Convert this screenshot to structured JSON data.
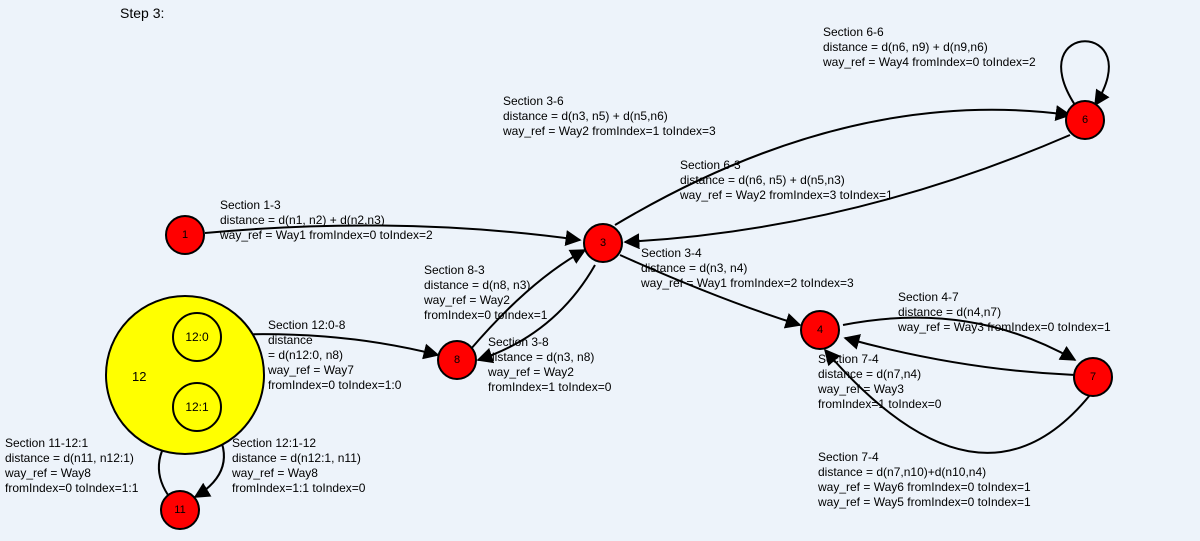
{
  "title": "Step 3:",
  "nodes": {
    "n1": "1",
    "n3": "3",
    "n4": "4",
    "n6": "6",
    "n7": "7",
    "n8": "8",
    "n11": "11",
    "n12": "12",
    "n12_0": "12:0",
    "n12_1": "12:1"
  },
  "sections": {
    "s66": {
      "title": "Section 6-6",
      "distance": "distance = d(n6, n9) + d(n9,n6)",
      "way": "way_ref = Way4 fromIndex=0 toIndex=2"
    },
    "s36": {
      "title": "Section 3-6",
      "distance": "distance = d(n3, n5) + d(n5,n6)",
      "way": "way_ref = Way2 fromIndex=1 toIndex=3"
    },
    "s63": {
      "title": "Section 6-3",
      "distance": "distance = d(n6, n5) + d(n5,n3)",
      "way": "way_ref = Way2 fromIndex=3 toIndex=1"
    },
    "s13": {
      "title": "Section 1-3",
      "distance": "distance = d(n1, n2) + d(n2,n3)",
      "way": "way_ref = Way1 fromIndex=0 toIndex=2"
    },
    "s34": {
      "title": "Section 3-4",
      "distance": "distance = d(n3, n4)",
      "way": "way_ref = Way1 fromIndex=2 toIndex=3"
    },
    "s83": {
      "title": "Section 8-3",
      "distance": "distance = d(n8, n3)",
      "way": "way_ref = Way2",
      "way2": "fromIndex=0 toIndex=1"
    },
    "s38": {
      "title": "Section 3-8",
      "distance": "distance = d(n3, n8)",
      "way": "way_ref = Way2",
      "way2": "fromIndex=1 toIndex=0"
    },
    "s47": {
      "title": "Section 4-7",
      "distance": "distance = d(n4,n7)",
      "way": "way_ref = Way3 fromIndex=0 toIndex=1"
    },
    "s74a": {
      "title": "Section 7-4",
      "distance": "distance = d(n7,n4)",
      "way": "way_ref = Way3",
      "way2": "fromIndex=1 toIndex=0"
    },
    "s74b": {
      "title": "Section 7-4",
      "distance": "distance = d(n7,n10)+d(n10,n4)",
      "way": "way_ref = Way6 fromIndex=0 toIndex=1",
      "way2": "way_ref = Way5 fromIndex=0 toIndex=1"
    },
    "s12_0_8": {
      "title": "Section 12:0-8",
      "distance": "distance",
      "distance2": "= d(n12:0, n8)",
      "way": "way_ref = Way7",
      "way2": "fromIndex=0 toIndex=1:0"
    },
    "s11_12_1": {
      "title": "Section 11-12:1",
      "distance": "distance = d(n11, n12:1)",
      "way": "way_ref = Way8",
      "way2": "fromIndex=0 toIndex=1:1"
    },
    "s12_1_12": {
      "title": "Section 12:1-12",
      "distance": "distance = d(n12:1, n11)",
      "way": "way_ref = Way8",
      "way2": "fromIndex=1:1 toIndex=0"
    }
  },
  "chart_data": {
    "type": "diagram",
    "title": "Step 3:",
    "nodes": [
      {
        "id": 1,
        "label": "1"
      },
      {
        "id": 3,
        "label": "3"
      },
      {
        "id": 4,
        "label": "4"
      },
      {
        "id": 6,
        "label": "6"
      },
      {
        "id": 7,
        "label": "7"
      },
      {
        "id": 8,
        "label": "8"
      },
      {
        "id": 11,
        "label": "11"
      },
      {
        "id": 12,
        "label": "12",
        "sub": [
          "12:0",
          "12:1"
        ]
      }
    ],
    "edges": [
      {
        "section": "1-3",
        "from": "1",
        "to": "3",
        "distance": "d(n1,n2)+d(n2,n3)",
        "way_ref": "Way1",
        "fromIndex": "0",
        "toIndex": "2"
      },
      {
        "section": "3-4",
        "from": "3",
        "to": "4",
        "distance": "d(n3,n4)",
        "way_ref": "Way1",
        "fromIndex": "2",
        "toIndex": "3"
      },
      {
        "section": "3-6",
        "from": "3",
        "to": "6",
        "distance": "d(n3,n5)+d(n5,n6)",
        "way_ref": "Way2",
        "fromIndex": "1",
        "toIndex": "3"
      },
      {
        "section": "6-3",
        "from": "6",
        "to": "3",
        "distance": "d(n6,n5)+d(n5,n3)",
        "way_ref": "Way2",
        "fromIndex": "3",
        "toIndex": "1"
      },
      {
        "section": "6-6",
        "from": "6",
        "to": "6",
        "distance": "d(n6,n9)+d(n9,n6)",
        "way_ref": "Way4",
        "fromIndex": "0",
        "toIndex": "2"
      },
      {
        "section": "8-3",
        "from": "8",
        "to": "3",
        "distance": "d(n8,n3)",
        "way_ref": "Way2",
        "fromIndex": "0",
        "toIndex": "1"
      },
      {
        "section": "3-8",
        "from": "3",
        "to": "8",
        "distance": "d(n3,n8)",
        "way_ref": "Way2",
        "fromIndex": "1",
        "toIndex": "0"
      },
      {
        "section": "4-7",
        "from": "4",
        "to": "7",
        "distance": "d(n4,n7)",
        "way_ref": "Way3",
        "fromIndex": "0",
        "toIndex": "1"
      },
      {
        "section": "7-4",
        "from": "7",
        "to": "4",
        "distance": "d(n7,n4)",
        "way_ref": "Way3",
        "fromIndex": "1",
        "toIndex": "0"
      },
      {
        "section": "7-4",
        "from": "7",
        "to": "4",
        "distance": "d(n7,n10)+d(n10,n4)",
        "way_ref": [
          "Way6",
          "Way5"
        ],
        "fromIndex": "0",
        "toIndex": "1"
      },
      {
        "section": "12:0-8",
        "from": "12:0",
        "to": "8",
        "distance": "d(n12:0,n8)",
        "way_ref": "Way7",
        "fromIndex": "0",
        "toIndex": "1:0"
      },
      {
        "section": "11-12:1",
        "from": "11",
        "to": "12:1",
        "distance": "d(n11,n12:1)",
        "way_ref": "Way8",
        "fromIndex": "0",
        "toIndex": "1:1"
      },
      {
        "section": "12:1-12",
        "from": "12:1",
        "to": "11",
        "distance": "d(n12:1,n11)",
        "way_ref": "Way8",
        "fromIndex": "1:1",
        "toIndex": "0"
      }
    ]
  }
}
